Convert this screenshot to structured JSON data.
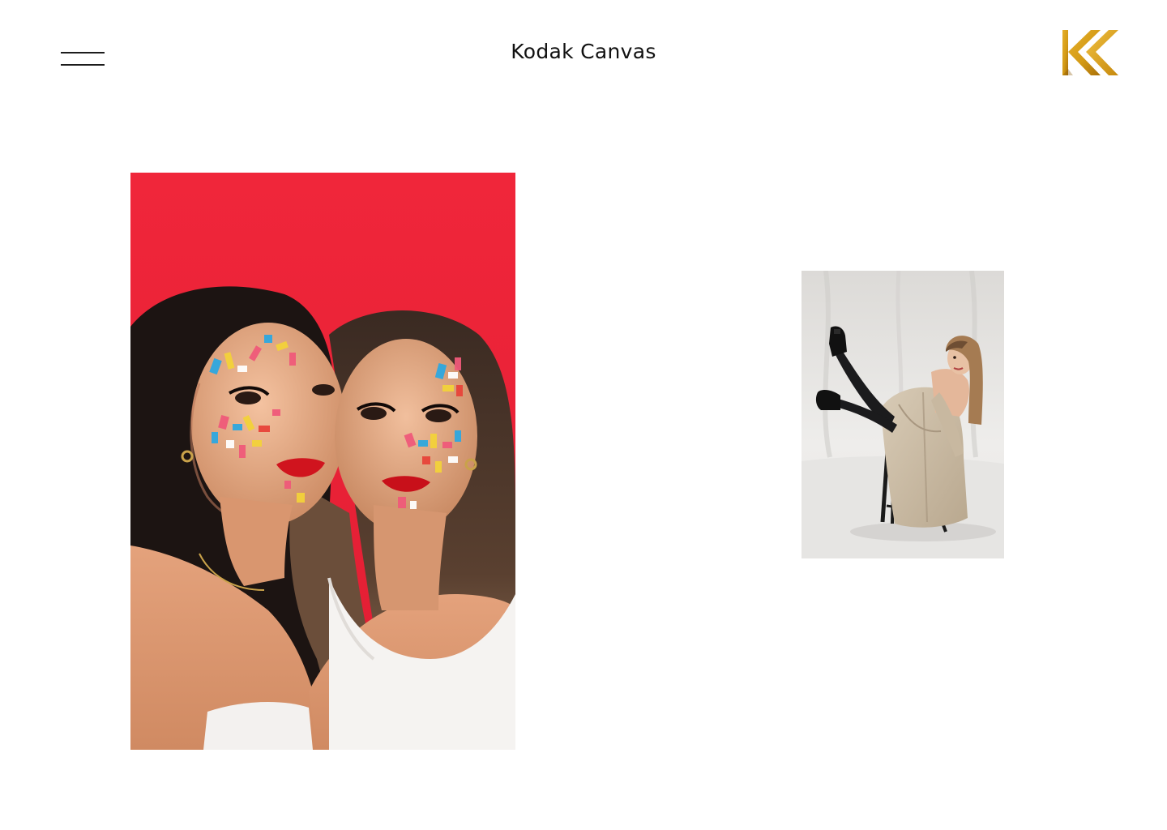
{
  "header": {
    "title": "Kodak Canvas",
    "menu_icon": "hamburger-menu-icon",
    "logo_icon": "kc-monogram-logo"
  },
  "colors": {
    "background": "#ffffff",
    "text": "#111111",
    "logo_gold": "#d49b16",
    "logo_gold_dark": "#b47a08",
    "photo_left_backdrop": "#f2283a",
    "photo_right_backdrop": "#e7e5e3"
  },
  "gallery": {
    "photos": [
      {
        "subject": "two-women-face-paint-portrait",
        "backdrop_color": "red"
      },
      {
        "subject": "woman-on-chair-trench-coat-legs-raised",
        "backdrop_color": "light-gray"
      }
    ]
  }
}
